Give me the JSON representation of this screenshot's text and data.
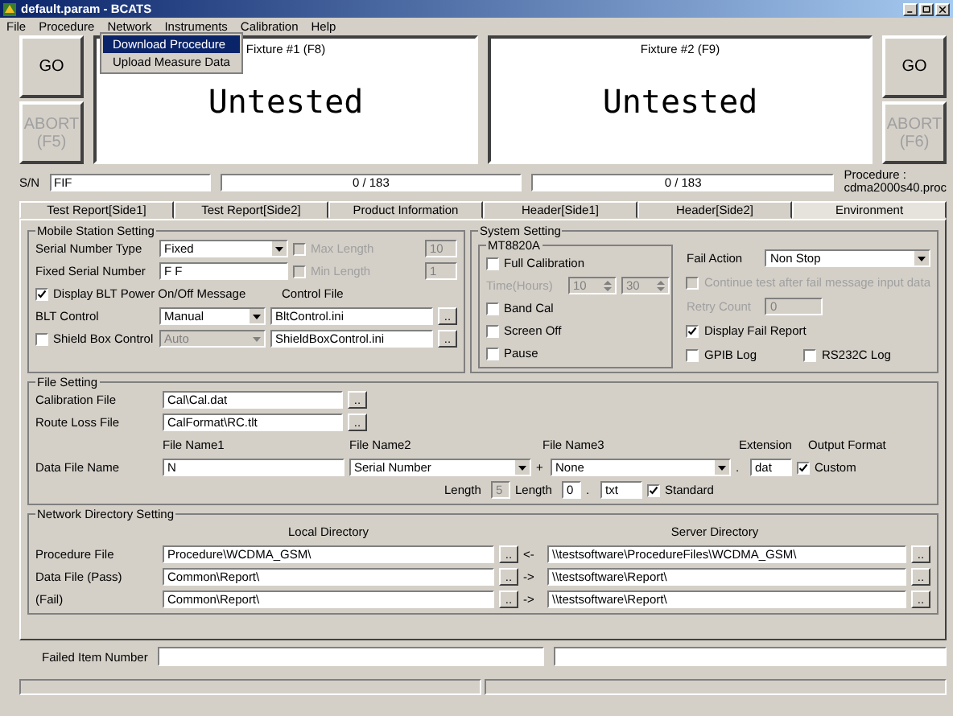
{
  "window": {
    "title": "default.param - BCATS"
  },
  "menu": [
    {
      "label": "File"
    },
    {
      "label": "Procedure"
    },
    {
      "label": "Network"
    },
    {
      "label": "Instruments"
    },
    {
      "label": "Calibration"
    },
    {
      "label": "Help"
    }
  ],
  "open_menu": [
    {
      "label": "Download Procedure",
      "selected": true
    },
    {
      "label": "Upload Measure Data",
      "selected": false
    }
  ],
  "left_buttons": [
    {
      "label": "GO",
      "disabled": false
    },
    {
      "label": "ABORT (F5)",
      "disabled": true
    }
  ],
  "right_buttons": [
    {
      "label": "GO",
      "disabled": false
    },
    {
      "label": "ABORT (F6)",
      "disabled": true
    }
  ],
  "fixtures": [
    {
      "title": "Fixture #1 (F8)",
      "status": "Untested",
      "count": "0 / 183"
    },
    {
      "title": "Fixture #2 (F9)",
      "status": "Untested",
      "count": "0 / 183"
    }
  ],
  "serial": {
    "label": "S/N",
    "value": "FIF"
  },
  "procedure": {
    "label": "Procedure :",
    "value": "cdma2000s40.proc"
  },
  "tabs": [
    {
      "label": "Test Report[Side1]",
      "selected": false
    },
    {
      "label": "Test Report[Side2]",
      "selected": false
    },
    {
      "label": "Product Information",
      "selected": false
    },
    {
      "label": "Header[Side1]",
      "selected": false
    },
    {
      "label": "Header[Side2]",
      "selected": false
    },
    {
      "label": "Environment",
      "selected": true
    }
  ],
  "mobile_station_setting": {
    "title": "Mobile Station Setting",
    "rows": [
      [
        {
          "kind": "label",
          "text": "Serial Number Type",
          "disabled": false
        },
        {
          "kind": "select",
          "value": "Fixed",
          "disabled": false
        },
        {
          "kind": "checkbox",
          "label": "Max Length",
          "checked": false,
          "disabled": true
        },
        {
          "kind": "input",
          "value": "10",
          "disabled": true
        }
      ],
      [
        {
          "kind": "label",
          "text": "Fixed Serial Number",
          "disabled": false
        },
        {
          "kind": "input",
          "value": "F F",
          "disabled": false
        },
        {
          "kind": "checkbox",
          "label": "Min Length",
          "checked": false,
          "disabled": true
        },
        {
          "kind": "input",
          "value": "1",
          "disabled": true
        }
      ],
      [
        {
          "kind": "checkbox",
          "label": "Display BLT Power On/Off Message",
          "checked": true,
          "disabled": false
        },
        {
          "kind": "label",
          "text": "Control File",
          "disabled": false
        }
      ],
      [
        {
          "kind": "label",
          "text": "BLT Control",
          "disabled": false
        },
        {
          "kind": "select",
          "value": "Manual",
          "disabled": false
        },
        {
          "kind": "input",
          "value": "BltControl.ini",
          "disabled": false
        },
        {
          "kind": "browse",
          "label": ".."
        }
      ],
      [
        {
          "kind": "checkbox",
          "label": "Shield Box Control",
          "checked": false,
          "disabled": false
        },
        {
          "kind": "select",
          "value": "Auto",
          "disabled": true
        },
        {
          "kind": "input",
          "value": "ShieldBoxControl.ini",
          "disabled": false
        },
        {
          "kind": "browse",
          "label": ".."
        }
      ]
    ]
  },
  "system_setting": {
    "title": "System Setting",
    "subgroup": {
      "title": "MT8820A",
      "rows": [
        [
          {
            "kind": "checkbox",
            "label": "Full Calibration",
            "checked": false,
            "disabled": false
          }
        ],
        [
          {
            "kind": "label",
            "text": "Time(Hours)",
            "disabled": true
          },
          {
            "kind": "spin",
            "value": "10",
            "disabled": true
          },
          {
            "kind": "spin",
            "value": "30",
            "disabled": true
          }
        ],
        [
          {
            "kind": "checkbox",
            "label": "Band Cal",
            "checked": false,
            "disabled": false
          }
        ],
        [
          {
            "kind": "checkbox",
            "label": "Screen Off",
            "checked": false,
            "disabled": false
          }
        ],
        [
          {
            "kind": "checkbox",
            "label": "Pause",
            "checked": false,
            "disabled": false
          }
        ]
      ]
    },
    "rows": [
      [
        {
          "kind": "label",
          "text": "Fail Action",
          "disabled": false
        },
        {
          "kind": "select",
          "value": "Non Stop",
          "disabled": false
        }
      ],
      [
        {
          "kind": "checkbox",
          "label": "Continue test after fail message input data",
          "checked": false,
          "disabled": true
        }
      ],
      [
        {
          "kind": "label",
          "text": "Retry Count",
          "disabled": true
        },
        {
          "kind": "input",
          "value": "0",
          "disabled": true
        }
      ],
      [
        {
          "kind": "checkbox",
          "label": "Display Fail Report",
          "checked": true,
          "disabled": false
        }
      ],
      [
        {
          "kind": "checkbox",
          "label": "GPIB Log",
          "checked": false,
          "disabled": false
        },
        {
          "kind": "checkbox",
          "label": "RS232C Log",
          "checked": false,
          "disabled": false
        }
      ]
    ]
  },
  "file_setting": {
    "title": "File Setting",
    "rows": [
      [
        {
          "kind": "label",
          "text": "Calibration File",
          "disabled": false
        },
        {
          "kind": "input",
          "value": "Cal\\Cal.dat",
          "disabled": false
        },
        {
          "kind": "browse",
          "label": ".."
        }
      ],
      [
        {
          "kind": "label",
          "text": "Route Loss File",
          "disabled": false
        },
        {
          "kind": "input",
          "value": "CalFormat\\RC.tlt",
          "disabled": false
        },
        {
          "kind": "browse",
          "label": ".."
        }
      ],
      [
        {
          "kind": "empty"
        },
        {
          "kind": "label",
          "text": "File Name1",
          "disabled": false
        },
        {
          "kind": "label",
          "text": "File Name2",
          "disabled": false
        },
        {
          "kind": "label",
          "text": "File Name3",
          "disabled": false
        },
        {
          "kind": "label",
          "text": "Extension",
          "disabled": false
        },
        {
          "kind": "label",
          "text": "Output Format",
          "disabled": false
        }
      ],
      [
        {
          "kind": "label",
          "text": "Data File Name",
          "disabled": false
        },
        {
          "kind": "input",
          "value": "N",
          "disabled": false
        },
        {
          "kind": "select",
          "value": "Serial Number",
          "disabled": false
        },
        {
          "kind": "label",
          "text": "+",
          "disabled": false
        },
        {
          "kind": "select",
          "value": "None",
          "disabled": false
        },
        {
          "kind": "label",
          "text": ".",
          "disabled": false
        },
        {
          "kind": "input",
          "value": "dat",
          "disabled": false
        },
        {
          "kind": "checkbox",
          "label": "Custom",
          "checked": true,
          "disabled": false
        }
      ],
      [
        {
          "kind": "empty"
        },
        {
          "kind": "label",
          "text": "Length",
          "disabled": false
        },
        {
          "kind": "input",
          "value": "5",
          "disabled": true
        },
        {
          "kind": "label",
          "text": "Length",
          "disabled": false
        },
        {
          "kind": "input",
          "value": "0",
          "disabled": false
        },
        {
          "kind": "label",
          "text": ".",
          "disabled": false
        },
        {
          "kind": "input",
          "value": "txt",
          "disabled": false
        },
        {
          "kind": "checkbox",
          "label": "Standard",
          "checked": true,
          "disabled": false
        }
      ]
    ]
  },
  "network_directory_setting": {
    "title": "Network Directory Setting",
    "rows": [
      [
        {
          "kind": "empty"
        },
        {
          "kind": "label",
          "text": "Local Directory",
          "disabled": false
        },
        {
          "kind": "label",
          "text": "Server Directory",
          "disabled": false
        }
      ],
      [
        {
          "kind": "label",
          "text": "Procedure File",
          "disabled": false
        },
        {
          "kind": "input",
          "value": "Procedure\\WCDMA_GSM\\",
          "disabled": false
        },
        {
          "kind": "browse",
          "label": ".."
        },
        {
          "kind": "label",
          "text": "<-",
          "disabled": false
        },
        {
          "kind": "input",
          "value": "\\\\testsoftware\\ProcedureFiles\\WCDMA_GSM\\",
          "disabled": false
        },
        {
          "kind": "browse",
          "label": ".."
        }
      ],
      [
        {
          "kind": "label",
          "text": "Data File (Pass)",
          "disabled": false
        },
        {
          "kind": "input",
          "value": "Common\\Report\\",
          "disabled": false
        },
        {
          "kind": "browse",
          "label": ".."
        },
        {
          "kind": "label",
          "text": "->",
          "disabled": false
        },
        {
          "kind": "input",
          "value": "\\\\testsoftware\\Report\\",
          "disabled": false
        },
        {
          "kind": "browse",
          "label": ".."
        }
      ],
      [
        {
          "kind": "label",
          "text": "(Fail)",
          "disabled": false
        },
        {
          "kind": "input",
          "value": "Common\\Report\\",
          "disabled": false
        },
        {
          "kind": "browse",
          "label": ".."
        },
        {
          "kind": "label",
          "text": "->",
          "disabled": false
        },
        {
          "kind": "input",
          "value": "\\\\testsoftware\\Report\\",
          "disabled": false
        },
        {
          "kind": "browse",
          "label": ".."
        }
      ]
    ]
  },
  "failed_item": {
    "label": "Failed Item Number"
  }
}
